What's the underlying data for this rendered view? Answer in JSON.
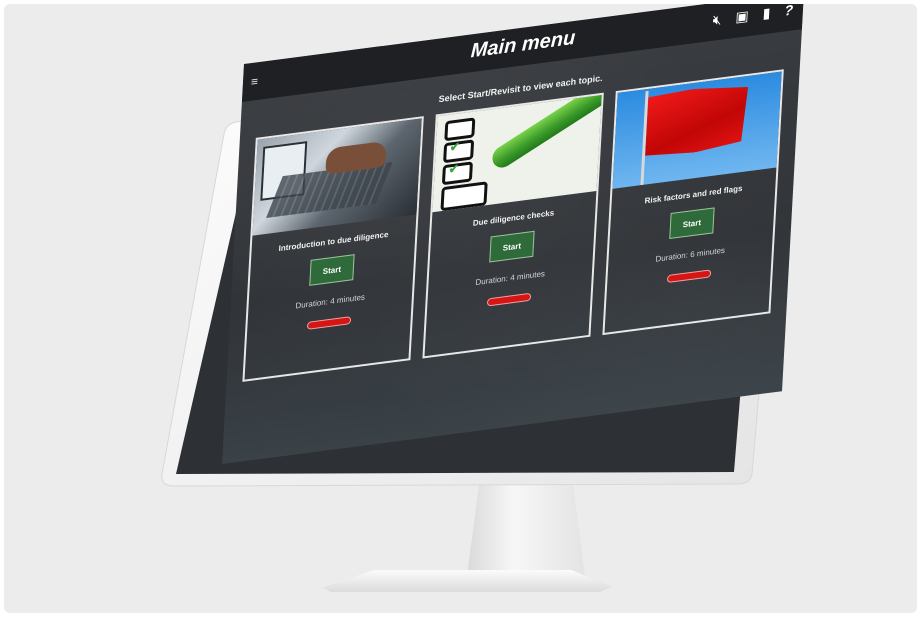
{
  "header": {
    "menu_icon": "≡",
    "title": "Main menu",
    "tools": [
      {
        "icon": "mute-speaker-icon",
        "glyph": "🔇︎"
      },
      {
        "icon": "briefcase-icon",
        "glyph": "▣"
      },
      {
        "icon": "book-icon",
        "glyph": "▮"
      },
      {
        "icon": "help-icon",
        "glyph": "?"
      }
    ]
  },
  "subtitle": "Select Start/Revisit to view each topic.",
  "cards": [
    {
      "title": "Introduction to due diligence",
      "button": "Start",
      "duration": "Duration: 4 minutes"
    },
    {
      "title": "Due diligence checks",
      "button": "Start",
      "duration": "Duration: 4 minutes"
    },
    {
      "title": "Risk factors and red flags",
      "button": "Start",
      "duration": "Duration: 6 minutes"
    }
  ],
  "colors": {
    "start_button": "#2f6b3a",
    "progress": "#d61515",
    "background": "#ececec"
  }
}
